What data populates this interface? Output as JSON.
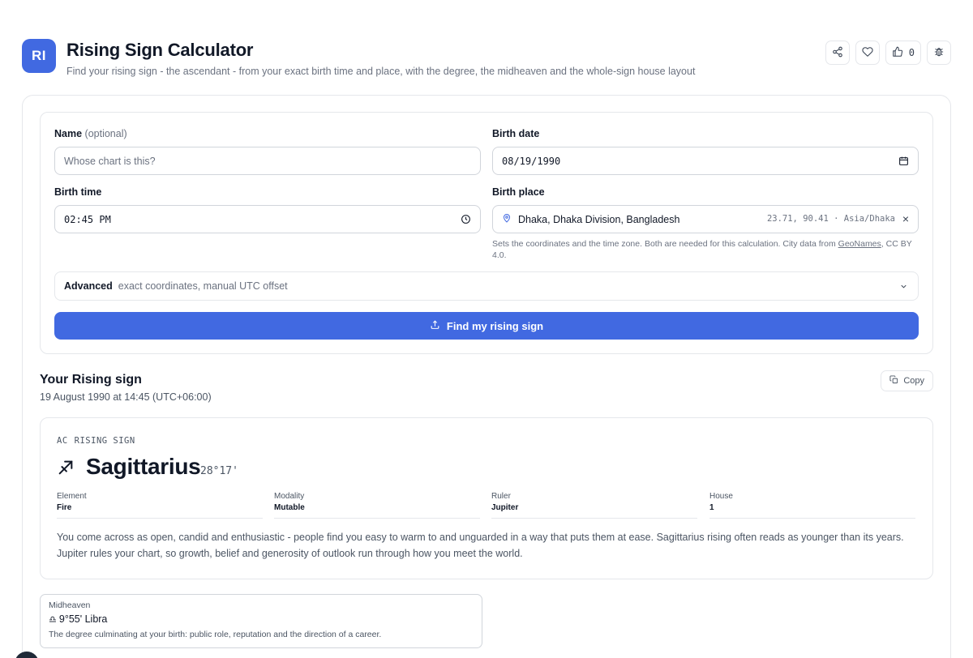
{
  "header": {
    "badge": "RI",
    "title": "Rising Sign Calculator",
    "subtitle": "Find your rising sign - the ascendant - from your exact birth time and place, with the degree, the midheaven and the whole-sign house layout",
    "actions": [
      {
        "icon": "share-icon"
      },
      {
        "icon": "heart-icon"
      },
      {
        "icon": "thumbs-up-icon",
        "count": "0"
      },
      {
        "icon": "bug-icon"
      }
    ]
  },
  "form": {
    "name_label": "Name",
    "name_optional": "(optional)",
    "name_placeholder": "Whose chart is this?",
    "birth_date_label": "Birth date",
    "birth_date_value": "08/19/1990",
    "birth_time_label": "Birth time",
    "birth_time_value": "02:45 PM",
    "birth_place_label": "Birth place",
    "birth_place_value": "Dhaka, Dhaka Division, Bangladesh",
    "birth_place_coords": "23.71, 90.41 · Asia/Dhaka",
    "birth_place_clear": "×",
    "helper_text": "Sets the coordinates and the time zone. Both are needed for this calculation. City data from ",
    "helper_link": "GeoNames",
    "helper_suffix": ", CC BY 4.0.",
    "advanced_title": "Advanced",
    "advanced_desc": "exact coordinates, manual UTC offset",
    "submit_label": "Find my rising sign"
  },
  "result": {
    "title": "Your Rising sign",
    "subtitle": "19 August 1990 at 14:45 (UTC+06:00)",
    "copy_label": "Copy",
    "eyebrow_code": "AC",
    "eyebrow_label": "RISING SIGN",
    "sign": "Sagittarius",
    "degree": "28°17'",
    "facts": [
      {
        "key": "Element",
        "value": "Fire"
      },
      {
        "key": "Modality",
        "value": "Mutable"
      },
      {
        "key": "Ruler",
        "value": "Jupiter"
      },
      {
        "key": "House",
        "value": "1"
      }
    ],
    "description": "You come across as open, candid and enthusiastic - people find you easy to warm to and unguarded in a way that puts them at ease. Sagittarius rising often reads as younger than its years. Jupiter rules your chart, so growth, belief and generosity of outlook run through how you meet the world.",
    "midheaven": {
      "label": "Midheaven",
      "glyph": "♎",
      "value": "9°55' Libra",
      "description": "The degree culminating at your birth: public role, reputation and the direction of a career."
    }
  },
  "colors": {
    "accent": "#4169e1",
    "text": "#111827",
    "muted": "#6b7280",
    "border": "#e5e7eb"
  }
}
